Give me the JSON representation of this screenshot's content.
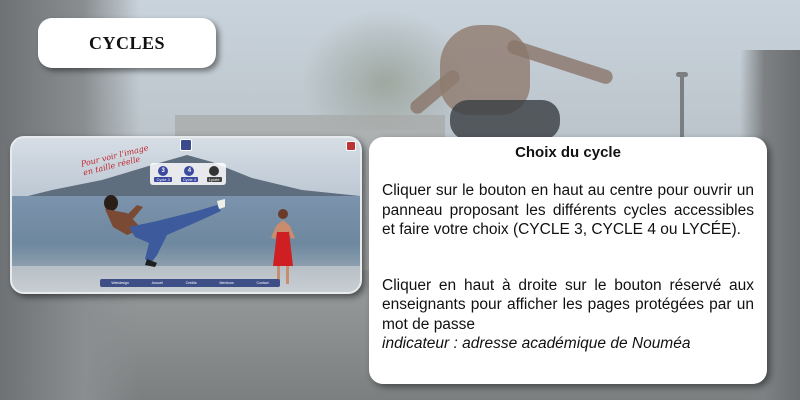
{
  "title": "CYCLES",
  "preview": {
    "handwritten": "Pour voir l'image\nen taille réelle",
    "cycles": [
      {
        "number": "3",
        "label": "Cycle 3"
      },
      {
        "number": "4",
        "label": "Cycle 4"
      },
      {
        "number": "",
        "label": "Lycée"
      }
    ],
    "bottom_links": [
      "Webdesign",
      "Accueil",
      "Crédits",
      "Mentions",
      "Contact"
    ]
  },
  "panel": {
    "heading": "Choix du cycle",
    "paragraph1": "Cliquer sur le bouton en haut au centre pour ouvrir un panneau proposant les différents cycles accessibles et faire votre choix (CYCLE 3, CYCLE 4 ou LYCÉE).",
    "paragraph2": "Cliquer en haut à droite sur le bouton réservé aux enseignants pour afficher les pages protégées par un mot de passe",
    "note": "indicateur : adresse académique de Nouméa"
  }
}
